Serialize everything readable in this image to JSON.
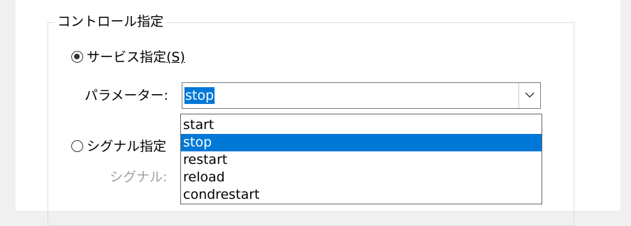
{
  "group": {
    "title": "コントロール指定"
  },
  "service": {
    "label": "サービス指定",
    "mnemonic": "(S)",
    "checked": true,
    "param_label": "パラメーター:",
    "param_value": "stop"
  },
  "signal": {
    "label": "シグナル指定",
    "checked": false,
    "signal_label": "シグナル:"
  },
  "dropdown": {
    "options": [
      "start",
      "stop",
      "restart",
      "reload",
      "condrestart"
    ],
    "selected": "stop"
  },
  "icons": {
    "dropdown_arrow": "chevron-down-icon"
  },
  "colors": {
    "selection": "#0078d7",
    "disabled_text": "#a0a0a0"
  }
}
